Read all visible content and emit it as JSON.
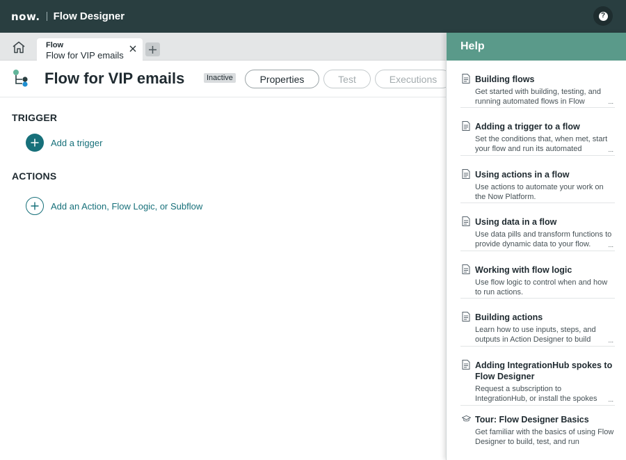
{
  "banner": {
    "logo": "now.",
    "app_name": "Flow Designer",
    "help_glyph": "?"
  },
  "tabs": {
    "active_tab": {
      "kind": "Flow",
      "name": "Flow for VIP emails"
    }
  },
  "header": {
    "title": "Flow for VIP emails",
    "status_badge": "Inactive",
    "properties_label": "Properties",
    "test_label": "Test",
    "executions_label": "Executions"
  },
  "canvas": {
    "trigger_heading": "TRIGGER",
    "add_trigger_label": "Add a trigger",
    "actions_heading": "ACTIONS",
    "add_action_label": "Add an Action, Flow Logic, or Subflow"
  },
  "help": {
    "title": "Help",
    "items": [
      {
        "title": "Building flows",
        "desc": "Get started with building, testing, and running automated flows in Flow",
        "more": "...",
        "icon": "document-icon"
      },
      {
        "title": "Adding a trigger to a flow",
        "desc": "Set the conditions that, when met, start your flow and run its automated",
        "more": "...",
        "icon": "document-icon"
      },
      {
        "title": "Using actions in a flow",
        "desc": "Use actions to automate your work on the Now Platform.",
        "more": "",
        "icon": "document-icon"
      },
      {
        "title": "Using data in a flow",
        "desc": "Use data pills and transform functions to provide dynamic data to your flow.",
        "more": "...",
        "icon": "document-icon"
      },
      {
        "title": "Working with flow logic",
        "desc": "Use flow logic to control when and how to run actions.",
        "more": "",
        "icon": "document-icon"
      },
      {
        "title": "Building actions",
        "desc": "Learn how to use inputs, steps, and outputs in Action Designer to build",
        "more": "...",
        "icon": "document-icon"
      },
      {
        "title": "Adding IntegrationHub spokes to Flow Designer",
        "desc": "Request a subscription to IntegrationHub, or install the spokes",
        "more": "...",
        "icon": "document-icon"
      },
      {
        "title": "Tour: Flow Designer Basics",
        "desc": "Get familiar with the basics of using Flow Designer to build, test, and run",
        "more": "",
        "icon": "graduation-cap-icon"
      }
    ]
  },
  "colors": {
    "banner": "#293e40",
    "accent": "#17707a",
    "help_header": "#5a9a8a"
  }
}
